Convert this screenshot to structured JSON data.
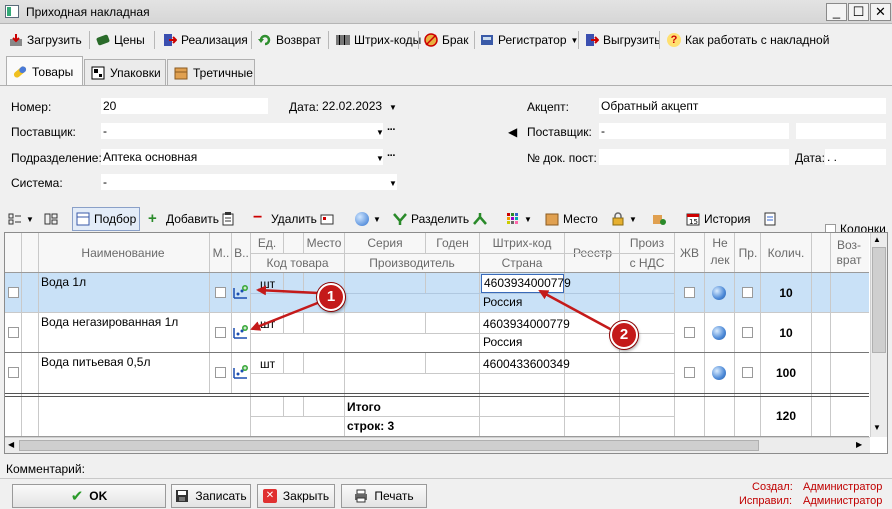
{
  "window": {
    "title": "Приходная накладная"
  },
  "toolbar": {
    "load": "Загрузить",
    "prices": "Цены",
    "sale": "Реализация",
    "return": "Возврат",
    "barcodes": "Штрих-коды",
    "defect": "Брак",
    "registrar": "Регистратор",
    "unload": "Выгрузить",
    "howto": "Как работать с накладной"
  },
  "tabs": [
    "Товары",
    "Упаковки",
    "Третичные"
  ],
  "form": {
    "number_label": "Номер:",
    "number": "20",
    "date_label": "Дата:",
    "date": "22.02.2023",
    "supplier_label": "Поставщик:",
    "supplier": "-",
    "division_label": "Подразделение:",
    "division": "Аптека основная",
    "system_label": "Система:",
    "system": "-",
    "acceptance_label": "Акцепт:",
    "acceptance": "Обратный акцепт",
    "supplier2_label": "Поставщик:",
    "supplier2": "-",
    "docno_label": "№ док. пост:",
    "docno": "",
    "date2_label": "Дата:",
    "date2": ". ."
  },
  "grid_toolbar": {
    "selection": "Подбор",
    "add": "Добавить",
    "delete": "Удалить",
    "split": "Разделить",
    "place": "Место",
    "history": "История",
    "columns": "Колонки"
  },
  "grid": {
    "headers": {
      "name": "Наименование",
      "m": "М..",
      "v": "В..",
      "unit": "Ед.",
      "place": "Место",
      "series": "Серия",
      "valid": "Годен",
      "barcode": "Штрих-код",
      "registry": "Реестр",
      "prod": "Произ",
      "vat": "с НДС",
      "zhv": "ЖВ",
      "ne": "Не",
      "lek": "лек",
      "pr": "Пр.",
      "qty": "Колич.",
      "ret1": "Воз-",
      "ret2": "врат",
      "code": "Код товара",
      "manufacturer": "Производитель",
      "country": "Страна"
    },
    "rows": [
      {
        "name": "Вода 1л",
        "unit": "шт",
        "barcode": "4603934000779",
        "country": "Россия",
        "qty": "10"
      },
      {
        "name": "Вода негазированная 1л",
        "unit": "шт",
        "barcode": "4603934000779",
        "country": "Россия",
        "qty": "10"
      },
      {
        "name": "Вода питьевая 0,5л",
        "unit": "шт",
        "barcode": "4600433600349",
        "country": "",
        "qty": "100"
      }
    ],
    "total_label": "Итого",
    "rows_label": "строк: 3",
    "total_qty": "120"
  },
  "footer": {
    "comment_label": "Комментарий:",
    "ok": "OK",
    "save": "Записать",
    "close": "Закрыть",
    "print": "Печать",
    "created_label": "Создал:",
    "created_by": "Администратор",
    "edited_label": "Исправил:",
    "edited_by": "Администратор"
  },
  "callouts": [
    "1",
    "2"
  ]
}
